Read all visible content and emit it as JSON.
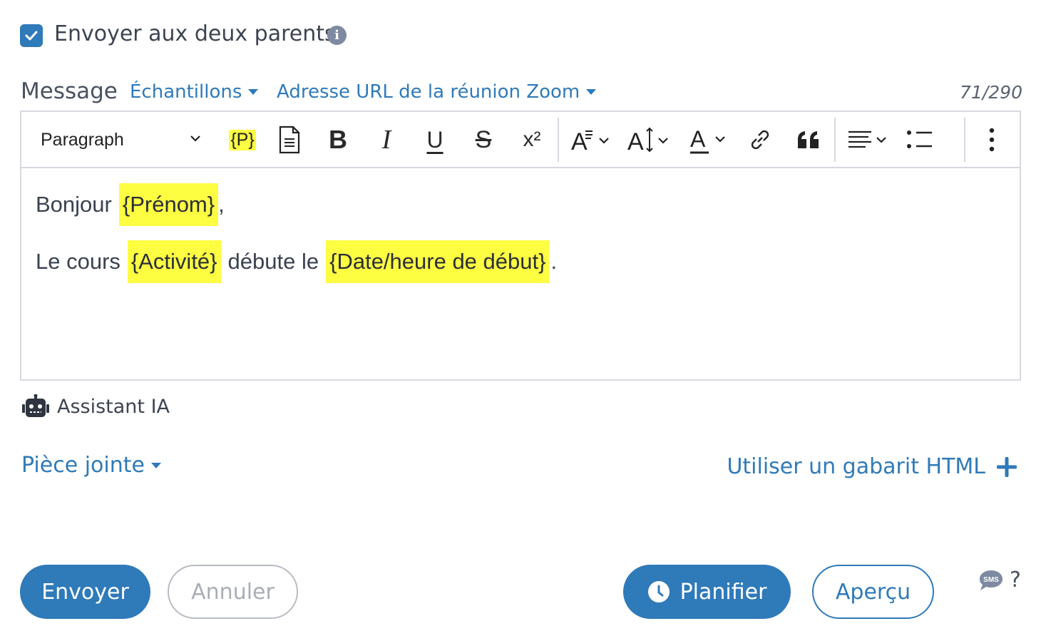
{
  "send_both_parents": {
    "checked": true,
    "label": "Envoyer aux deux parents"
  },
  "message": {
    "label": "Message",
    "samples_dropdown": "Échantillons",
    "zoom_dropdown": "Adresse URL de la réunion Zoom",
    "char_counter": "71/290"
  },
  "toolbar": {
    "block_format": "Paragraph",
    "placeholder_button": "{P}",
    "superscript": "x²"
  },
  "editor": {
    "line1": {
      "text1": "Bonjour",
      "tag1": "{Prénom}",
      "text2": ","
    },
    "line2": {
      "text1": "Le cours",
      "tag1": "{Activité}",
      "text2": "débute le",
      "tag2": "{Date/heure de début}",
      "text3": "."
    }
  },
  "assistant": {
    "label": "Assistant IA"
  },
  "attachment": {
    "label": "Pièce jointe"
  },
  "html_template": {
    "label": "Utiliser un gabarit HTML"
  },
  "actions": {
    "send": "Envoyer",
    "cancel": "Annuler",
    "schedule": "Planifier",
    "preview": "Aperçu",
    "sms_badge": "SMS",
    "help": "?"
  },
  "colors": {
    "accent": "#2f7ab9",
    "highlight": "#fdfd42",
    "border": "#d6d9de"
  }
}
